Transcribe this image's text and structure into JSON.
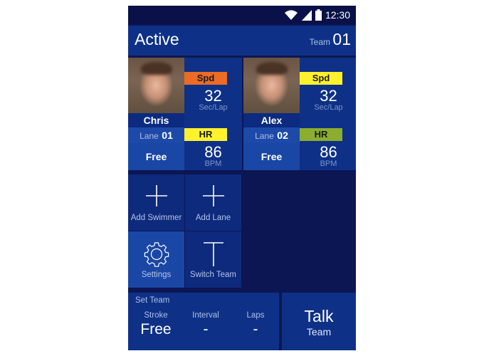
{
  "status": {
    "time": "12:30"
  },
  "header": {
    "title": "Active",
    "team_label": "Team",
    "team_number": "01"
  },
  "swimmers": [
    {
      "name": "Chris",
      "lane_label": "Lane",
      "lane_number": "01",
      "stroke": "Free",
      "speed": {
        "badge": "Spd",
        "badge_color": "#ec6b25",
        "value": "32",
        "unit": "Sec/Lap"
      },
      "heart": {
        "badge": "HR",
        "badge_color": "#fff22d",
        "value": "86",
        "unit": "BPM"
      }
    },
    {
      "name": "Alex",
      "lane_label": "Lane",
      "lane_number": "02",
      "stroke": "Free",
      "speed": {
        "badge": "Spd",
        "badge_color": "#fff22d",
        "value": "32",
        "unit": "Sec/Lap"
      },
      "heart": {
        "badge": "HR",
        "badge_color": "#8cad2e",
        "value": "86",
        "unit": "BPM"
      }
    }
  ],
  "actions": {
    "add_swimmer": "Add Swimmer",
    "add_lane": "Add Lane",
    "settings": "Settings",
    "switch_team": "Switch Team"
  },
  "set_team": {
    "heading": "Set Team",
    "stroke_label": "Stroke",
    "stroke_value": "Free",
    "interval_label": "Interval",
    "interval_value": "-",
    "laps_label": "Laps",
    "laps_value": "-"
  },
  "talk": {
    "title": "Talk",
    "subtitle": "Team"
  },
  "colors": {
    "background": "#0c1652",
    "panel": "#0e3187",
    "tile_dark": "#0d2a7d",
    "tile_light": "#1a47a5"
  }
}
